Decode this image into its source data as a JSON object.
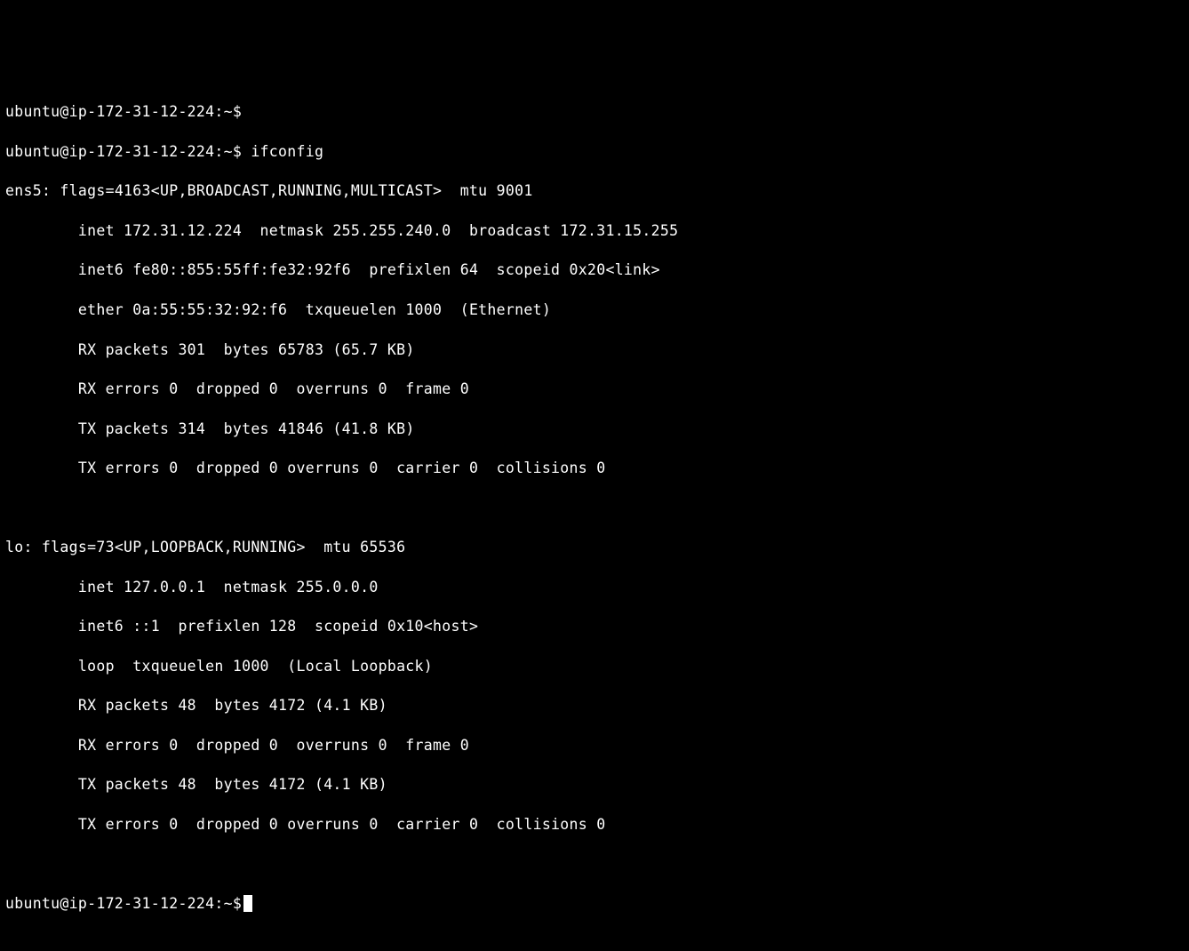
{
  "prompt": "ubuntu@ip-172-31-12-224:~$",
  "command": "ifconfig",
  "ens5": {
    "name": "ens5",
    "flags_num": "4163",
    "flags_list": "UP,BROADCAST,RUNNING,MULTICAST",
    "mtu": "9001",
    "inet": "172.31.12.224",
    "netmask": "255.255.240.0",
    "broadcast": "172.31.15.255",
    "inet6": "fe80::855:55ff:fe32:92f6",
    "prefixlen": "64",
    "scopeid": "0x20<link>",
    "ether": "0a:55:55:32:92:f6",
    "txqueuelen": "1000",
    "iface_type": "Ethernet",
    "rx_packets": "301",
    "rx_bytes": "65783",
    "rx_bytes_h": "65.7 KB",
    "rx_errors": "0",
    "rx_dropped": "0",
    "rx_overruns": "0",
    "rx_frame": "0",
    "tx_packets": "314",
    "tx_bytes": "41846",
    "tx_bytes_h": "41.8 KB",
    "tx_errors": "0",
    "tx_dropped": "0",
    "tx_overruns": "0",
    "tx_carrier": "0",
    "tx_collisions": "0"
  },
  "lo": {
    "name": "lo",
    "flags_num": "73",
    "flags_list": "UP,LOOPBACK,RUNNING",
    "mtu": "65536",
    "inet": "127.0.0.1",
    "netmask": "255.0.0.0",
    "inet6": "::1",
    "prefixlen": "128",
    "scopeid": "0x10<host>",
    "loop_label": "loop",
    "txqueuelen": "1000",
    "iface_type": "Local Loopback",
    "rx_packets": "48",
    "rx_bytes": "4172",
    "rx_bytes_h": "4.1 KB",
    "rx_errors": "0",
    "rx_dropped": "0",
    "rx_overruns": "0",
    "rx_frame": "0",
    "tx_packets": "48",
    "tx_bytes": "4172",
    "tx_bytes_h": "4.1 KB",
    "tx_errors": "0",
    "tx_dropped": "0",
    "tx_overruns": "0",
    "tx_carrier": "0",
    "tx_collisions": "0"
  }
}
